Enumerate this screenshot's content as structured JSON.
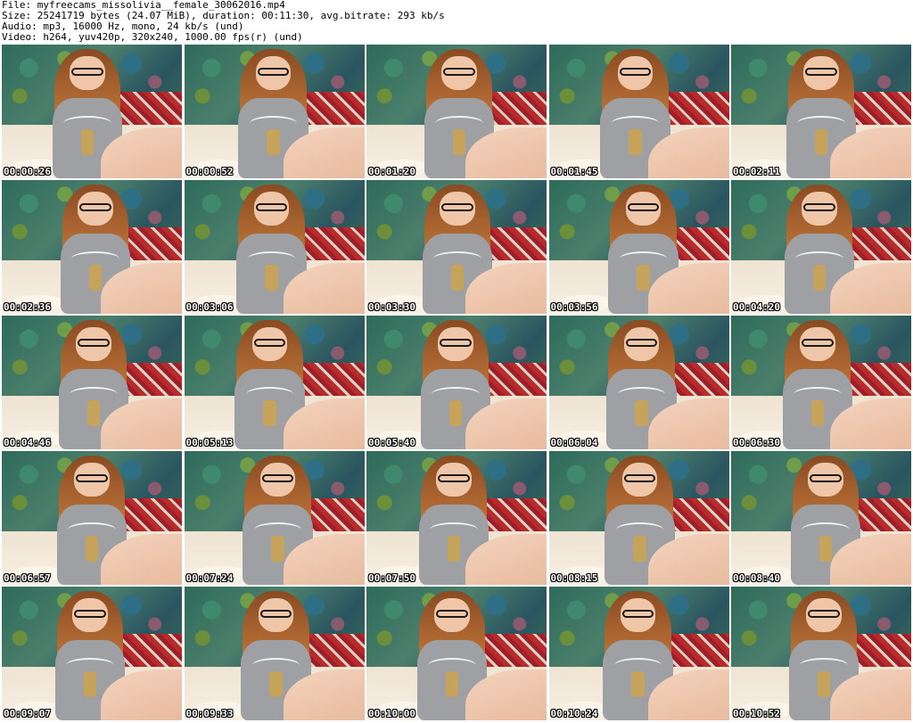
{
  "header": {
    "file": "File: myfreecams_missolivia__female_30062016.mp4",
    "size": "Size: 25241719 bytes (24.07 MiB), duration: 00:11:30, avg.bitrate: 293 kb/s",
    "audio": "Audio: mp3, 16000 Hz, mono, 24 kb/s (und)",
    "video": "Video: h264, yuv420p, 320x240, 1000.00 fps(r) (und)"
  },
  "thumbnails": [
    {
      "timestamp": "00:00:26"
    },
    {
      "timestamp": "00:00:52"
    },
    {
      "timestamp": "00:01:20"
    },
    {
      "timestamp": "00:01:45"
    },
    {
      "timestamp": "00:02:11"
    },
    {
      "timestamp": "00:02:36"
    },
    {
      "timestamp": "00:03:06"
    },
    {
      "timestamp": "00:03:30"
    },
    {
      "timestamp": "00:03:56"
    },
    {
      "timestamp": "00:04:20"
    },
    {
      "timestamp": "00:04:46"
    },
    {
      "timestamp": "00:05:13"
    },
    {
      "timestamp": "00:05:40"
    },
    {
      "timestamp": "00:06:04"
    },
    {
      "timestamp": "00:06:30"
    },
    {
      "timestamp": "00:06:57"
    },
    {
      "timestamp": "00:07:24"
    },
    {
      "timestamp": "00:07:50"
    },
    {
      "timestamp": "00:08:15"
    },
    {
      "timestamp": "00:08:40"
    },
    {
      "timestamp": "00:09:07"
    },
    {
      "timestamp": "00:09:33"
    },
    {
      "timestamp": "00:10:00"
    },
    {
      "timestamp": "00:10:24"
    },
    {
      "timestamp": "00:10:52"
    }
  ],
  "colors": {
    "background": "#ffffff",
    "timestamp_text": "#ffffff",
    "timestamp_outline": "#000000",
    "shirt": "#9ea0a3",
    "wallpaper": "#2e6b5b",
    "sofa": "#b92b2b"
  }
}
